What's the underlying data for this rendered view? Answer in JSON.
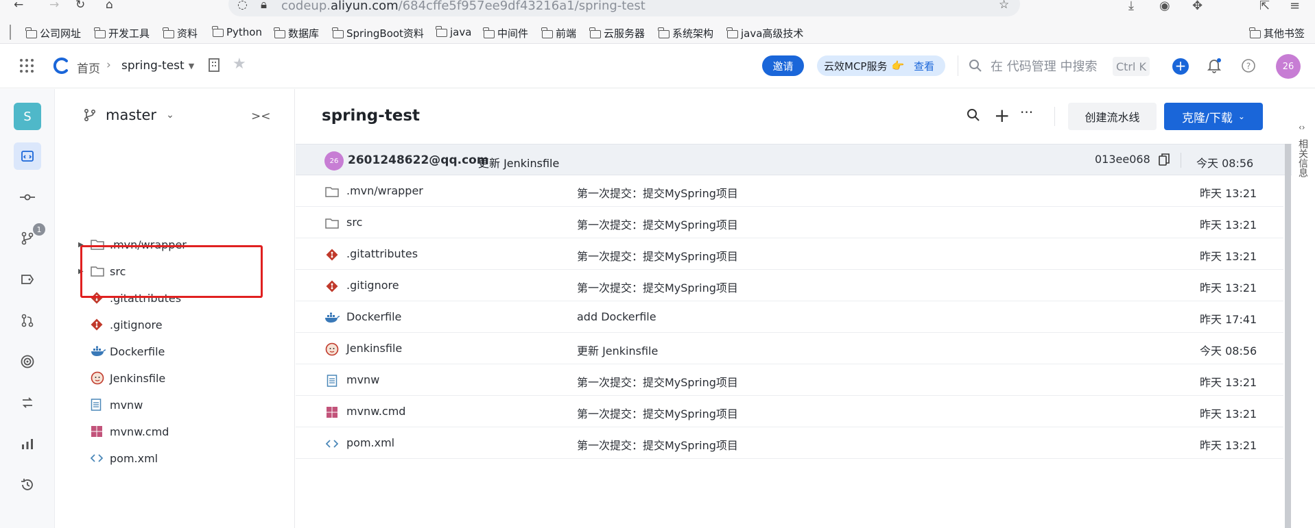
{
  "browser": {
    "url_prefix": "codeup.",
    "url_domain": "aliyun.com",
    "url_path": "/684cffe5f957ee9df43216a1/spring-test"
  },
  "bookmarks": {
    "items": [
      "公司网址",
      "开发工具",
      "资料",
      "Python",
      "数据库",
      "SpringBoot资料",
      "java",
      "中间件",
      "前端",
      "云服务器",
      "系统架构",
      "java高级技术"
    ],
    "other": "其他书签"
  },
  "header": {
    "home": "首页",
    "repo": "spring-test",
    "invite": "邀请",
    "mcp_label": "云效MCP服务",
    "mcp_view": "查看",
    "search_placeholder": "在 代码管理 中搜索",
    "shortcut": "Ctrl K",
    "avatar": "26"
  },
  "rail": {
    "space_letter": "S",
    "mr_badge": "1"
  },
  "tree": {
    "branch": "master",
    "items": [
      {
        "name": ".mvn/wrapper",
        "type": "folder"
      },
      {
        "name": "src",
        "type": "folder"
      },
      {
        "name": ".gitattributes",
        "type": "git"
      },
      {
        "name": ".gitignore",
        "type": "git"
      },
      {
        "name": "Dockerfile",
        "type": "docker"
      },
      {
        "name": "Jenkinsfile",
        "type": "jenkins"
      },
      {
        "name": "mvnw",
        "type": "text"
      },
      {
        "name": "mvnw.cmd",
        "type": "windows"
      },
      {
        "name": "pom.xml",
        "type": "code"
      }
    ]
  },
  "main": {
    "title": "spring-test",
    "create_pipeline": "创建流水线",
    "clone_download": "克隆/下载",
    "latest_commit": {
      "avatar": "26",
      "author": "2601248622@qq.com",
      "message": "更新 Jenkinsfile",
      "hash": "013ee068",
      "time": "今天 08:56"
    },
    "files": [
      {
        "name": ".mvn/wrapper",
        "message": "第一次提交：提交MySpring项目",
        "time": "昨天 13:21"
      },
      {
        "name": "src",
        "message": "第一次提交：提交MySpring项目",
        "time": "昨天 13:21"
      },
      {
        "name": ".gitattributes",
        "message": "第一次提交：提交MySpring项目",
        "time": "昨天 13:21"
      },
      {
        "name": ".gitignore",
        "message": "第一次提交：提交MySpring项目",
        "time": "昨天 13:21"
      },
      {
        "name": "Dockerfile",
        "message": "add Dockerfile",
        "time": "昨天 17:41"
      },
      {
        "name": "Jenkinsfile",
        "message": "更新 Jenkinsfile",
        "time": "今天 08:56"
      },
      {
        "name": "mvnw",
        "message": "第一次提交：提交MySpring项目",
        "time": "昨天 13:21"
      },
      {
        "name": "mvnw.cmd",
        "message": "第一次提交：提交MySpring项目",
        "time": "昨天 13:21"
      },
      {
        "name": "pom.xml",
        "message": "第一次提交：提交MySpring项目",
        "time": "昨天 13:21"
      }
    ],
    "side_panel": "相关信息"
  },
  "colors": {
    "accent": "#1a66d9",
    "highlight_box": "#e02020",
    "avatar": "#c77dd4"
  }
}
